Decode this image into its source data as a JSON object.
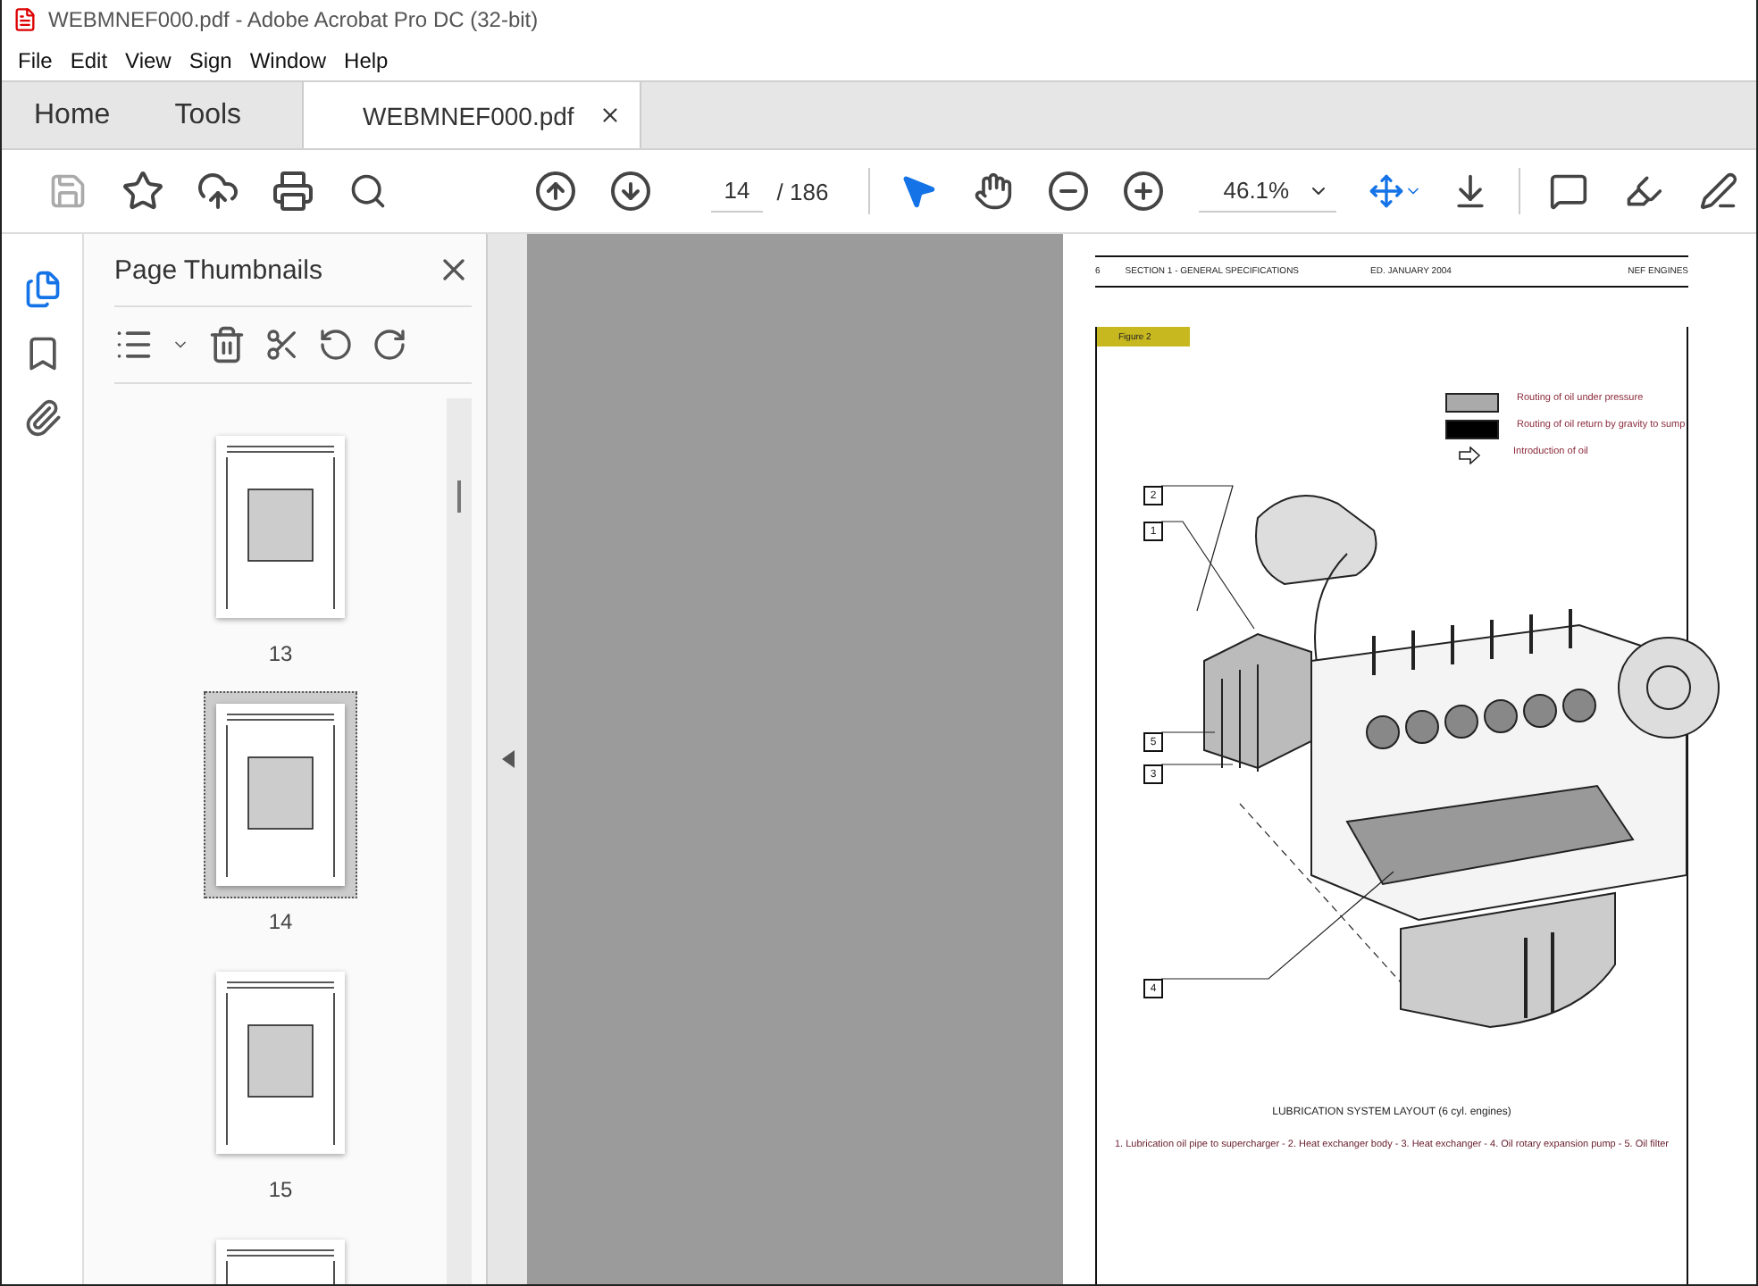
{
  "window": {
    "title": "WEBMNEF000.pdf - Adobe Acrobat Pro DC (32-bit)"
  },
  "menu": [
    "File",
    "Edit",
    "View",
    "Sign",
    "Window",
    "Help"
  ],
  "tabs": [
    {
      "label": "Home",
      "kind": "nav",
      "selected": false
    },
    {
      "label": "Tools",
      "kind": "nav",
      "selected": false
    },
    {
      "label": "WEBMNEF000.pdf",
      "kind": "document",
      "selected": true
    }
  ],
  "toolbar": {
    "save_disabled": true,
    "page": "14",
    "page_total": "/ 186",
    "zoom": "46.1%",
    "tools": [
      {
        "kind": "select",
        "selected": true
      },
      {
        "kind": "hand",
        "selected": false
      }
    ]
  },
  "rail": [
    {
      "kind": "thumbnails",
      "selected": true
    },
    {
      "kind": "bookmarks",
      "selected": false
    },
    {
      "kind": "attachments",
      "selected": false
    }
  ],
  "panel": {
    "title": "Page Thumbnails",
    "thumbnails": [
      {
        "label": "13",
        "selected": false
      },
      {
        "label": "14",
        "selected": true
      },
      {
        "label": "15",
        "selected": false
      },
      {
        "selected": false
      }
    ]
  },
  "document": {
    "header": {
      "page_number": "6",
      "section": "SECTION 1 - GENERAL SPECIFICATIONS",
      "edition": "ED. JANUARY 2004",
      "product": "NEF ENGINES"
    },
    "figure_label": "Figure 2",
    "legend": [
      {
        "kind": "pressure",
        "label": "Routing of oil under pressure"
      },
      {
        "kind": "return",
        "label": "Routing of oil return by gravity to sump"
      },
      {
        "kind": "arrow",
        "label": "Introduction of oil"
      }
    ],
    "callouts": [
      "2",
      "1",
      "5",
      "3",
      "4"
    ],
    "caption": "LUBRICATION SYSTEM LAYOUT (6 cyl. engines)",
    "parts": "1. Lubrication oil pipe to supercharger - 2. Heat exchanger body - 3. Heat exchanger - 4. Oil rotary expansion pump - 5. Oil filter"
  }
}
